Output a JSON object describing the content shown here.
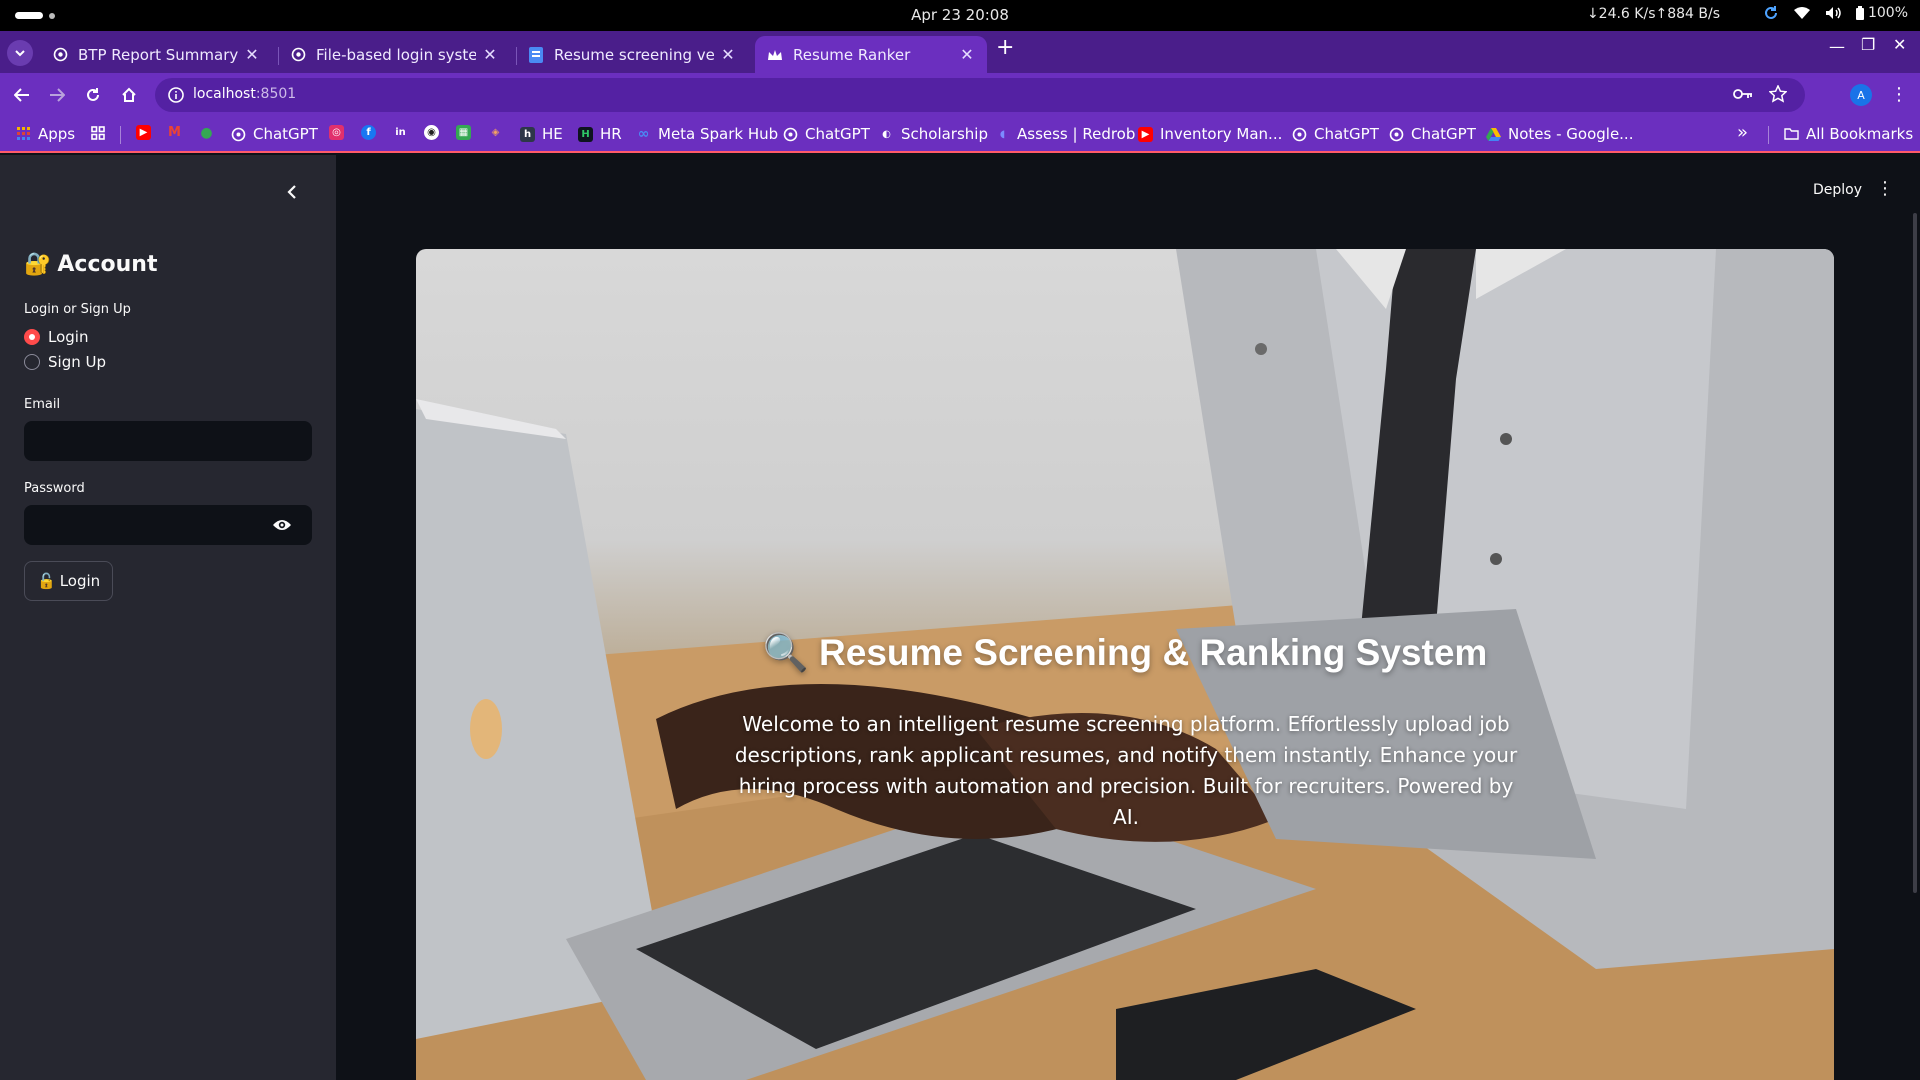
{
  "os": {
    "clock": "Apr 23  20:08",
    "network": "↓24.6 K/s↑884 B/s",
    "battery": "100%"
  },
  "tabs": [
    {
      "title": "BTP Report Summary",
      "active": false
    },
    {
      "title": "File-based login system",
      "active": false
    },
    {
      "title": "Resume screening vecto",
      "active": false
    },
    {
      "title": "Resume Ranker",
      "active": true
    }
  ],
  "address": {
    "host": "localhost",
    "port": ":8501"
  },
  "profile_initial": "A",
  "bookmarks": {
    "apps": "Apps",
    "chatgpt1": "ChatGPT",
    "he": "HE",
    "hr": "HR",
    "meta": "Meta Spark Hub",
    "chatgpt2": "ChatGPT",
    "scholarship": "Scholarship",
    "assess": "Assess | Redrob",
    "inventory": "Inventory Man...",
    "chatgpt3": "ChatGPT",
    "chatgpt4": "ChatGPT",
    "notes": "Notes - Google...",
    "all": "All Bookmarks"
  },
  "sidebar": {
    "title": "Account",
    "title_emoji": "🔐",
    "mode_label": "Login or Sign Up",
    "options": [
      "Login",
      "Sign Up"
    ],
    "selected": "Login",
    "email_label": "Email",
    "email_value": "",
    "password_label": "Password",
    "password_value": "",
    "login_button": "Login",
    "login_button_emoji": "🔓"
  },
  "header": {
    "deploy": "Deploy"
  },
  "hero": {
    "emoji": "🔍",
    "title": "Resume Screening & Ranking System",
    "description": "Welcome to an intelligent resume screening platform. Effortlessly upload job descriptions, rank applicant resumes, and notify them instantly. Enhance your hiring process with automation and precision. Built for recruiters. Powered by AI."
  },
  "colors": {
    "accent": "#ff4b4b",
    "browser_theme": "#6b2fbf",
    "app_bg": "#0e1117",
    "sidebar_bg": "#262730"
  }
}
